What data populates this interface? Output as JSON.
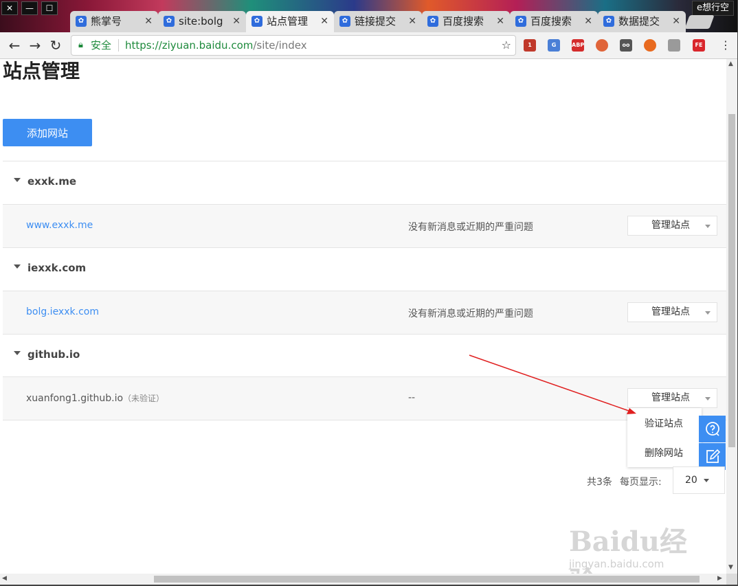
{
  "window": {
    "close": "✕",
    "minimize": "—",
    "maximize": "☐",
    "profile": "e想行空"
  },
  "tabs": [
    {
      "title": "熊掌号",
      "icon": "baidu-paw-icon"
    },
    {
      "title": "site:bolg",
      "icon": "baidu-paw-icon"
    },
    {
      "title": "站点管理",
      "icon": "baidu-paw-icon"
    },
    {
      "title": "链接提交",
      "icon": "baidu-paw-icon"
    },
    {
      "title": "百度搜索",
      "icon": "baidu-paw-icon"
    },
    {
      "title": "百度搜索",
      "icon": "baidu-paw-icon"
    },
    {
      "title": "数据提交",
      "icon": "baidu-paw-icon"
    }
  ],
  "tab_close": "✕",
  "toolbar": {
    "back": "←",
    "forward": "→",
    "reload": "↻",
    "secure_label": "安全",
    "url_host": "https://ziyuan.baidu.com",
    "url_path": "/site/index",
    "star": "☆",
    "menu": "⋮",
    "extensions": [
      {
        "name": "mail-checker-icon",
        "label": "1",
        "color": "#c0392b"
      },
      {
        "name": "translate-icon",
        "label": "G",
        "color": "#4a7fd6"
      },
      {
        "name": "adblock-icon",
        "label": "ABP",
        "color": "#d42b2b"
      },
      {
        "name": "record-icon",
        "label": "",
        "color": "#e0653a"
      },
      {
        "name": "reader-icon",
        "label": "oo",
        "color": "#555555"
      },
      {
        "name": "ublock-icon",
        "label": "",
        "color": "#e86a1f"
      },
      {
        "name": "screenshot-icon",
        "label": "",
        "color": "#9a9a9a"
      },
      {
        "name": "fe-helper-icon",
        "label": "FE",
        "color": "#d9262c"
      }
    ]
  },
  "page": {
    "title": "站点管理",
    "add_button": "添加网站",
    "groups": [
      {
        "name": "exxk.me",
        "site": "www.exxk.me",
        "note": "",
        "status": "没有新消息或近期的严重问题",
        "manage": "管理站点"
      },
      {
        "name": "iexxk.com",
        "site": "bolg.iexxk.com",
        "note": "",
        "status": "没有新消息或近期的严重问题",
        "manage": "管理站点"
      },
      {
        "name": "github.io",
        "site": "xuanfong1.github.io",
        "note": "（未验证）",
        "status": "--",
        "manage": "管理站点"
      }
    ],
    "dropdown": [
      "验证站点",
      "删除网站"
    ],
    "pager": {
      "total": "共3条",
      "per_page_label": "每页显示:",
      "per_page_value": "20"
    }
  },
  "watermark": {
    "logo": "Baidu经验",
    "url": "jingyan.baidu.com"
  },
  "colors": {
    "accent": "#3d8ef2",
    "secure_green": "#1e8a3c",
    "annotation_arrow": "#e02020"
  }
}
